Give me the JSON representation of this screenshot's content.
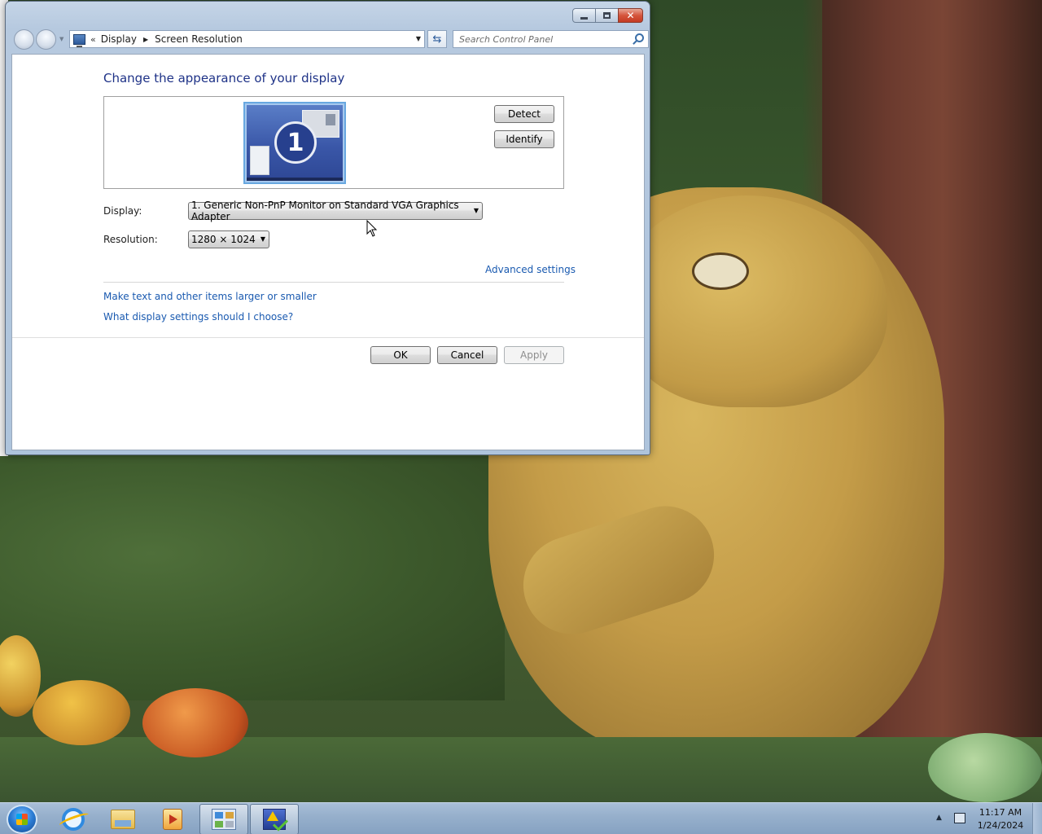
{
  "window": {
    "title_buttons": {
      "minimize_icon": "minimize-icon",
      "maximize_icon": "maximize-icon",
      "close_icon": "close-icon",
      "close_glyph": "✕"
    }
  },
  "navbar": {
    "chevron": "«",
    "breadcrumbs": [
      "Display",
      "Screen Resolution"
    ],
    "search_placeholder": "Search Control Panel",
    "refresh_glyph": "⇆"
  },
  "main": {
    "heading": "Change the appearance of your display",
    "monitor_number": "1",
    "detect_label": "Detect",
    "identify_label": "Identify",
    "display_label": "Display:",
    "display_value": "1. Generic Non-PnP Monitor on Standard VGA Graphics Adapter",
    "resolution_label": "Resolution:",
    "resolution_value": "1280 × 1024",
    "advanced_link": "Advanced settings",
    "link_larger": "Make text and other items larger or smaller",
    "link_choose": "What display settings should I choose?",
    "ok_label": "OK",
    "cancel_label": "Cancel",
    "apply_label": "Apply"
  },
  "taskbar": {
    "items": [
      "start-orb",
      "internet-explorer-icon",
      "file-explorer-icon",
      "media-player-icon",
      "control-panel-icon",
      "action-center-icon"
    ],
    "time": "11:17 AM",
    "date": "1/24/2024"
  },
  "colors": {
    "heading": "#1e3287",
    "link": "#1a5ab0",
    "close_button": "#c43a22"
  }
}
